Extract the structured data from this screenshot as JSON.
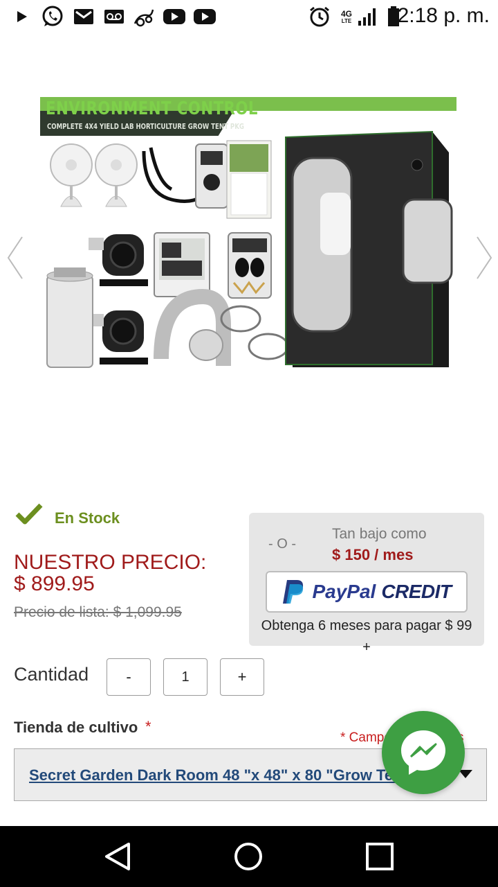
{
  "status_bar": {
    "time": "2:18 p. m.",
    "network": "4G",
    "network_sub": "LTE",
    "icons": [
      "play-icon",
      "whatsapp-icon",
      "gmail-icon",
      "voicemail-icon",
      "app-icon",
      "youtube-icon",
      "youtube-icon",
      "alarm-icon",
      "signal-icon",
      "battery-icon"
    ]
  },
  "product": {
    "image": {
      "banner_title": "ENVIRONMENT CONTROL",
      "banner_subtitle": "COMPLETE 4X4 YIELD LAB HORTICULTURE GROW TENT PKG"
    },
    "stock": "En Stock",
    "price_label": "NUESTRO PRECIO:",
    "price": "$ 899.95",
    "list_price": "Precio de lista: $ 1,099.95"
  },
  "paypal": {
    "or": "- O -",
    "low_as": "Tan bajo como",
    "monthly": "$ 150 / mes",
    "brand": "PayPal",
    "credit": "CREDIT",
    "note": "Obtenga 6 meses para pagar $ 99 +"
  },
  "quantity": {
    "label": "Cantidad",
    "minus": "-",
    "value": "1",
    "plus": "+"
  },
  "options": {
    "label": "Tienda de cultivo",
    "required_star": "*",
    "required_note": "* Campos requeridos",
    "selected": "Secret Garden Dark Room 48 \"x 48\" x 80 \"Grow Tent"
  },
  "colors": {
    "price_red": "#a01b1b",
    "stock_green": "#6c8f1f",
    "messenger_green": "#3e9f43",
    "paypal_blue": "#2a3b8f"
  }
}
